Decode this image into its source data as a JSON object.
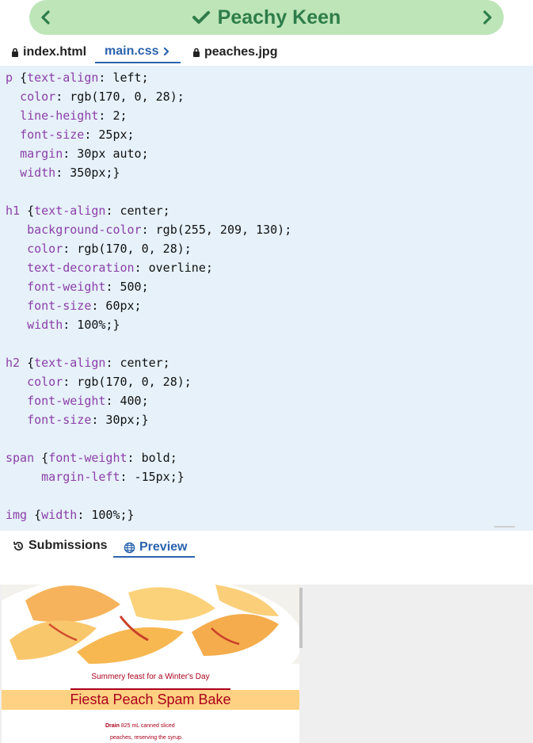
{
  "header": {
    "title": "Peachy Keen",
    "prev_icon": "chevron-left-icon",
    "next_icon": "chevron-right-icon",
    "status_icon": "check-icon",
    "bg_color": "#bde5b8",
    "text_color": "#2e7d4a"
  },
  "tabs": [
    {
      "label": "index.html",
      "icon": "lock-icon"
    },
    {
      "label": "main.css",
      "icon": "chevron-right-icon",
      "active": true
    },
    {
      "label": "peaches.jpg",
      "icon": "lock-icon"
    }
  ],
  "code_lines": [
    [
      [
        "sel",
        "p "
      ],
      [
        "val",
        "{"
      ],
      [
        "prop",
        "text-align"
      ],
      [
        "val",
        ": left;"
      ]
    ],
    [
      [
        "val",
        "  "
      ],
      [
        "prop",
        "color"
      ],
      [
        "val",
        ": rgb(170, 0, 28);"
      ]
    ],
    [
      [
        "val",
        "  "
      ],
      [
        "prop",
        "line-height"
      ],
      [
        "val",
        ": 2;"
      ]
    ],
    [
      [
        "val",
        "  "
      ],
      [
        "prop",
        "font-size"
      ],
      [
        "val",
        ": 25px;"
      ]
    ],
    [
      [
        "val",
        "  "
      ],
      [
        "prop",
        "margin"
      ],
      [
        "val",
        ": 30px auto;"
      ]
    ],
    [
      [
        "val",
        "  "
      ],
      [
        "prop",
        "width"
      ],
      [
        "val",
        ": 350px;}"
      ]
    ],
    [],
    [
      [
        "sel",
        "h1 "
      ],
      [
        "val",
        "{"
      ],
      [
        "prop",
        "text-align"
      ],
      [
        "val",
        ": center;"
      ]
    ],
    [
      [
        "val",
        "   "
      ],
      [
        "prop",
        "background-color"
      ],
      [
        "val",
        ": rgb(255, 209, 130);"
      ]
    ],
    [
      [
        "val",
        "   "
      ],
      [
        "prop",
        "color"
      ],
      [
        "val",
        ": rgb(170, 0, 28);"
      ]
    ],
    [
      [
        "val",
        "   "
      ],
      [
        "prop",
        "text-decoration"
      ],
      [
        "val",
        ": overline;"
      ]
    ],
    [
      [
        "val",
        "   "
      ],
      [
        "prop",
        "font-weight"
      ],
      [
        "val",
        ": 500;"
      ]
    ],
    [
      [
        "val",
        "   "
      ],
      [
        "prop",
        "font-size"
      ],
      [
        "val",
        ": 60px;"
      ]
    ],
    [
      [
        "val",
        "   "
      ],
      [
        "prop",
        "width"
      ],
      [
        "val",
        ": 100%;}"
      ]
    ],
    [],
    [
      [
        "sel",
        "h2 "
      ],
      [
        "val",
        "{"
      ],
      [
        "prop",
        "text-align"
      ],
      [
        "val",
        ": center;"
      ]
    ],
    [
      [
        "val",
        "   "
      ],
      [
        "prop",
        "color"
      ],
      [
        "val",
        ": rgb(170, 0, 28);"
      ]
    ],
    [
      [
        "val",
        "   "
      ],
      [
        "prop",
        "font-weight"
      ],
      [
        "val",
        ": 400;"
      ]
    ],
    [
      [
        "val",
        "   "
      ],
      [
        "prop",
        "font-size"
      ],
      [
        "val",
        ": 30px;}"
      ]
    ],
    [],
    [
      [
        "sel",
        "span "
      ],
      [
        "val",
        "{"
      ],
      [
        "prop",
        "font-weight"
      ],
      [
        "val",
        ": bold;"
      ]
    ],
    [
      [
        "val",
        "     "
      ],
      [
        "prop",
        "margin-left"
      ],
      [
        "val",
        ": -15px;}"
      ]
    ],
    [],
    [
      [
        "sel",
        "img "
      ],
      [
        "val",
        "{"
      ],
      [
        "prop",
        "width"
      ],
      [
        "val",
        ": 100%;}"
      ]
    ]
  ],
  "panel_tabs": [
    {
      "label": "Submissions",
      "icon": "history-icon"
    },
    {
      "label": "Preview",
      "icon": "globe-icon",
      "active": true
    }
  ],
  "preview": {
    "subtitle": "Summery feast for a Winter's Day",
    "heading": "Fiesta Peach Spam Bake",
    "text_bold": "Drain",
    "text_line1": " 825 mL canned sliced",
    "text_line2": "peaches, reserving the syrup."
  },
  "colors": {
    "editor_bg": "#e6f1fa",
    "keyword": "#8b3fa8",
    "accent": "#2a63ad",
    "preview_red": "#aa001c",
    "preview_peach": "#ffd182"
  }
}
